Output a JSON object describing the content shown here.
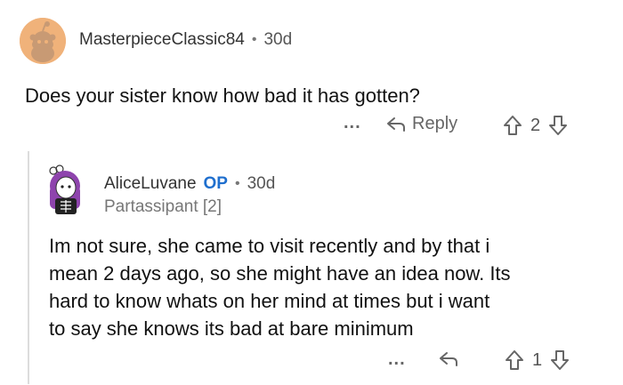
{
  "comment1": {
    "username": "MasterpieceClassic84",
    "separator": "•",
    "age": "30d",
    "body": "Does your sister know how bad it has gotten?",
    "more": "...",
    "reply_label": "Reply",
    "votes": "2"
  },
  "comment2": {
    "username": "AliceLuvane",
    "op_badge": "OP",
    "separator": "•",
    "age": "30d",
    "flair": "Partassipant [2]",
    "body_lines": [
      "Im not sure, she came to visit recently and by that i",
      "mean 2 days ago, so she might have an idea now. Its",
      "hard to know whats on her mind at times but i want",
      "to say she knows its bad at bare minimum"
    ],
    "more": "...",
    "votes": "1"
  },
  "colors": {
    "avatar_bg": "#f0b27a",
    "op_blue": "#1f6fce",
    "avatar2_hair": "#8e44ad"
  },
  "icons": [
    "reddit-snoo-avatar-icon",
    "reply-arrow-icon",
    "upvote-arrow-icon",
    "downvote-arrow-icon",
    "more-dots-icon",
    "custom-avatar-icon"
  ]
}
